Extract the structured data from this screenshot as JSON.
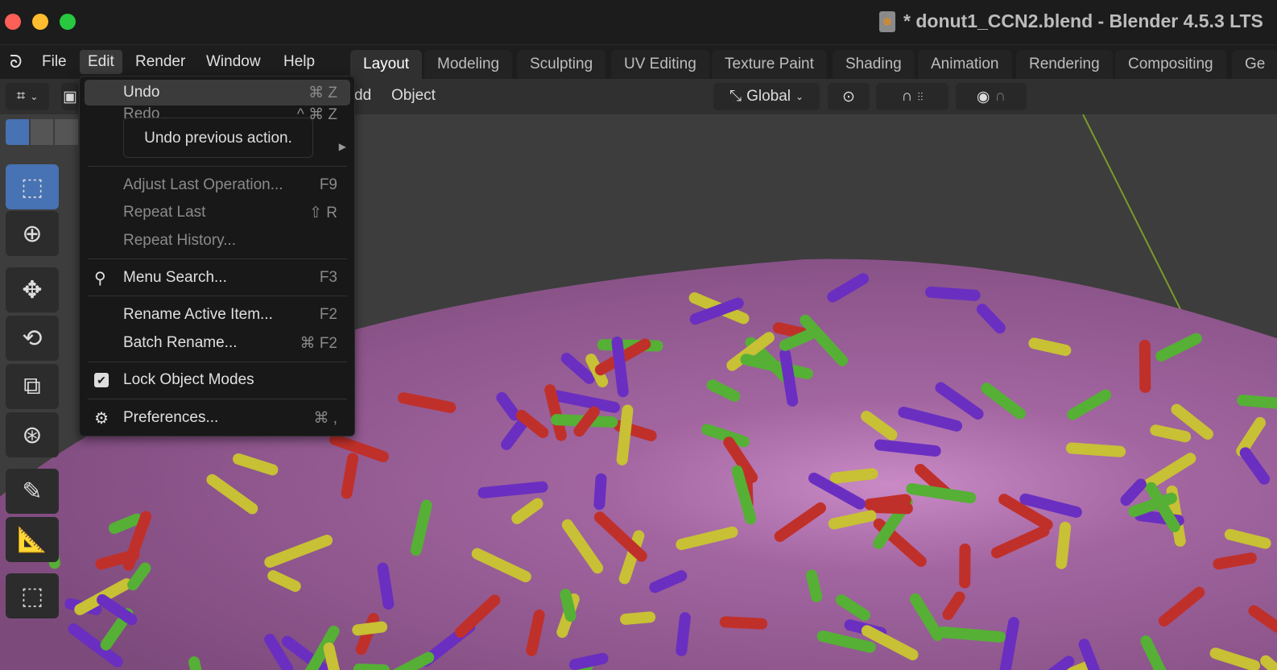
{
  "window": {
    "title": "* donut1_CCN2.blend - Blender 4.5.3 LTS"
  },
  "menubar": {
    "items": [
      "File",
      "Edit",
      "Render",
      "Window",
      "Help"
    ]
  },
  "workspaces": [
    "Layout",
    "Modeling",
    "Sculpting",
    "UV Editing",
    "Texture Paint",
    "Shading",
    "Animation",
    "Rendering",
    "Compositing",
    "Ge"
  ],
  "header": {
    "add_partial": "dd",
    "object": "Object",
    "orientation": "Global"
  },
  "edit_menu": {
    "undo": {
      "label": "Undo",
      "shortcut": "⌘ Z"
    },
    "redo": {
      "label": "Redo",
      "shortcut": "^ ⌘ Z"
    },
    "tooltip": "Undo previous action.",
    "adjust": {
      "label": "Adjust Last Operation...",
      "shortcut": "F9"
    },
    "repeat_last": {
      "label": "Repeat Last",
      "shortcut": "⇧ R"
    },
    "repeat_history": {
      "label": "Repeat History..."
    },
    "menu_search": {
      "label": "Menu Search...",
      "shortcut": "F3"
    },
    "rename_active": {
      "label": "Rename Active Item...",
      "shortcut": "F2"
    },
    "batch_rename": {
      "label": "Batch Rename...",
      "shortcut": "⌘ F2"
    },
    "lock_modes": {
      "label": "Lock Object Modes",
      "checked": true
    },
    "preferences": {
      "label": "Preferences...",
      "shortcut": "⌘ ,"
    }
  },
  "colors": {
    "accent": "#4772b3",
    "icing": "#a0609f",
    "sprinkles": [
      "#c0302a",
      "#6a2fc0",
      "#55b035",
      "#c8c035"
    ]
  }
}
